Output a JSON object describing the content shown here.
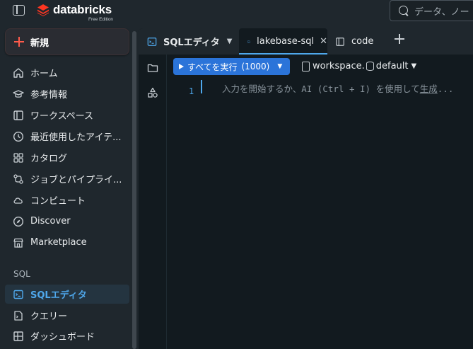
{
  "header": {
    "logo_text": "databricks",
    "logo_subtext": "Free Edition",
    "search_placeholder": "データ、ノー"
  },
  "sidebar": {
    "new_button_label": "新規",
    "items": [
      {
        "label": "ホーム",
        "icon": "home-icon"
      },
      {
        "label": "参考情報",
        "icon": "graduation-cap-icon"
      },
      {
        "label": "ワークスペース",
        "icon": "workspace-icon"
      },
      {
        "label": "最近使用したアイテ...",
        "icon": "clock-icon"
      },
      {
        "label": "カタログ",
        "icon": "catalog-icon"
      },
      {
        "label": "ジョブとパイプライ...",
        "icon": "workflow-icon"
      },
      {
        "label": "コンピュート",
        "icon": "cloud-icon"
      },
      {
        "label": "Discover",
        "icon": "compass-icon"
      },
      {
        "label": "Marketplace",
        "icon": "storefront-icon"
      }
    ],
    "sql_section_title": "SQL",
    "sql_items": [
      {
        "label": "SQLエディタ",
        "icon": "sql-editor-icon",
        "active": true
      },
      {
        "label": "クエリー",
        "icon": "query-icon"
      },
      {
        "label": "ダッシュボード",
        "icon": "dashboard-icon"
      }
    ]
  },
  "tabs": [
    {
      "label": "SQLエディタ",
      "icon": "sql-editor-icon",
      "has_dropdown": true
    },
    {
      "label": "lakebase-sql",
      "icon": "sql-file-icon",
      "active": true,
      "has_close": true
    },
    {
      "label": "code",
      "icon": "notebook-icon"
    }
  ],
  "toolbar": {
    "run_label": "すべてを実行",
    "run_count": "(1000)",
    "catalog": "workspace",
    "separator": ".",
    "schema": "default"
  },
  "editor": {
    "line_number": "1",
    "placeholder_prefix": "入力を開始するか、AI (Ctrl + I) を使用して",
    "placeholder_link": "生成",
    "placeholder_suffix": "..."
  },
  "colors": {
    "accent_blue": "#2b74d9",
    "active_text": "#4fa8ec",
    "brand_red": "#ff3621"
  }
}
